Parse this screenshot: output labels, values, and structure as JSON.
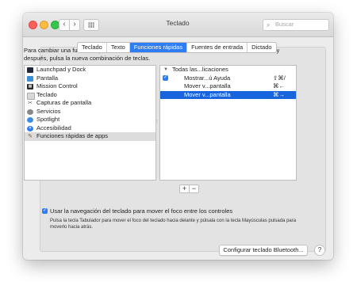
{
  "window": {
    "title": "Teclado",
    "search_placeholder": "Buscar"
  },
  "toolbar": {
    "back_glyph": "‹",
    "forward_glyph": "›"
  },
  "tabs": [
    {
      "label": "Teclado",
      "active": false
    },
    {
      "label": "Texto",
      "active": false
    },
    {
      "label": "Funciones rápidas",
      "active": true
    },
    {
      "label": "Fuentes de entrada",
      "active": false
    },
    {
      "label": "Dictado",
      "active": false
    }
  ],
  "description": "Para cambiar una función rápida de teclado, selecciónala, haz clic en la combinación de teclas, y después, pulsa la nueva combinación de teclas.",
  "categories": [
    {
      "label": "Launchpad y Dock",
      "icon": "launchpad-icon"
    },
    {
      "label": "Pantalla",
      "icon": "display-icon"
    },
    {
      "label": "Mission Control",
      "icon": "mission-control-icon"
    },
    {
      "label": "Teclado",
      "icon": "keyboard-icon"
    },
    {
      "label": "Capturas de pantalla",
      "icon": "screenshot-icon"
    },
    {
      "label": "Servicios",
      "icon": "gear-icon"
    },
    {
      "label": "Spotlight",
      "icon": "spotlight-icon"
    },
    {
      "label": "Accesibilidad",
      "icon": "accessibility-icon"
    },
    {
      "label": "Funciones rápidas de apps",
      "icon": "app-shortcuts-icon",
      "selected": true
    }
  ],
  "shortcuts": {
    "group_label": "Todas las...licaciones",
    "items": [
      {
        "label": "Mostrar...ú Ayuda",
        "shortcut": "⇧⌘/",
        "checked": true
      },
      {
        "label": "Mover v...pantalla",
        "shortcut": "⌘←",
        "checked": false
      },
      {
        "label": "Mover v...pantalla",
        "shortcut": "⌘→",
        "checked": false,
        "selected": true
      }
    ]
  },
  "buttons": {
    "add": "+",
    "remove": "−",
    "bluetooth": "Configurar teclado Bluetooth...",
    "help": "?"
  },
  "options": {
    "keyboard_nav_label": "Usar la navegación del teclado para mover el foco entre los controles",
    "keyboard_nav_checked": true,
    "keyboard_nav_help": "Pulsa la tecla Tabulador para mover el foco del teclado hacia delante y púlsala con la tecla Mayúsculas pulsada para moverlo hacia atrás."
  },
  "colors": {
    "accent": "#2f7df5",
    "selection": "#1864dc"
  }
}
